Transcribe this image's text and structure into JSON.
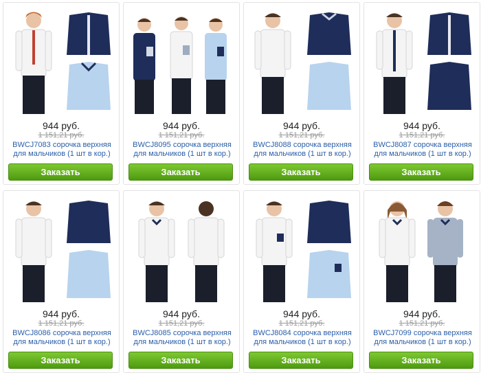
{
  "products": [
    {
      "price": "944 руб.",
      "old_price": "1 151,21 руб.",
      "title": "BWCJ7083 сорочка верхняя для мальчиков (1 шт в кор.)",
      "button": "Заказать"
    },
    {
      "price": "944 руб.",
      "old_price": "1 151,21 руб.",
      "title": "BWCJ8095 сорочка верхняя для мальчиков (1 шт в кор.)",
      "button": "Заказать"
    },
    {
      "price": "944 руб.",
      "old_price": "1 151,21 руб.",
      "title": "BWCJ8088 сорочка верхняя для мальчиков (1 шт в кор.)",
      "button": "Заказать"
    },
    {
      "price": "944 руб.",
      "old_price": "1 151,21 руб.",
      "title": "BWCJ8087 сорочка верхняя для мальчиков (1 шт в кор.)",
      "button": "Заказать"
    },
    {
      "price": "944 руб.",
      "old_price": "1 151,21 руб.",
      "title": "BWCJ8086 сорочка верхняя для мальчиков (1 шт в кор.)",
      "button": "Заказать"
    },
    {
      "price": "944 руб.",
      "old_price": "1 151,21 руб.",
      "title": "BWCJ8085 сорочка верхняя для мальчиков (1 шт в кор.)",
      "button": "Заказать"
    },
    {
      "price": "944 руб.",
      "old_price": "1 151,21 руб.",
      "title": "BWCJ8084 сорочка верхняя для мальчиков (1 шт в кор.)",
      "button": "Заказать"
    },
    {
      "price": "944 руб.",
      "old_price": "1 151,21 руб.",
      "title": "BWCJ7099 сорочка верхняя для мальчиков (1 шт в кор.)",
      "button": "Заказать"
    }
  ],
  "colors": {
    "navy": "#1f2d5a",
    "white_shirt": "#f4f4f4",
    "light_blue": "#b7d3ee",
    "gray_blue": "#a6b3c6",
    "pants": "#1b1e2b",
    "skin": "#e9c3a6",
    "hair": "#6b3f22",
    "button_green": "#5fae1a",
    "link_blue": "#2a5ea8"
  }
}
